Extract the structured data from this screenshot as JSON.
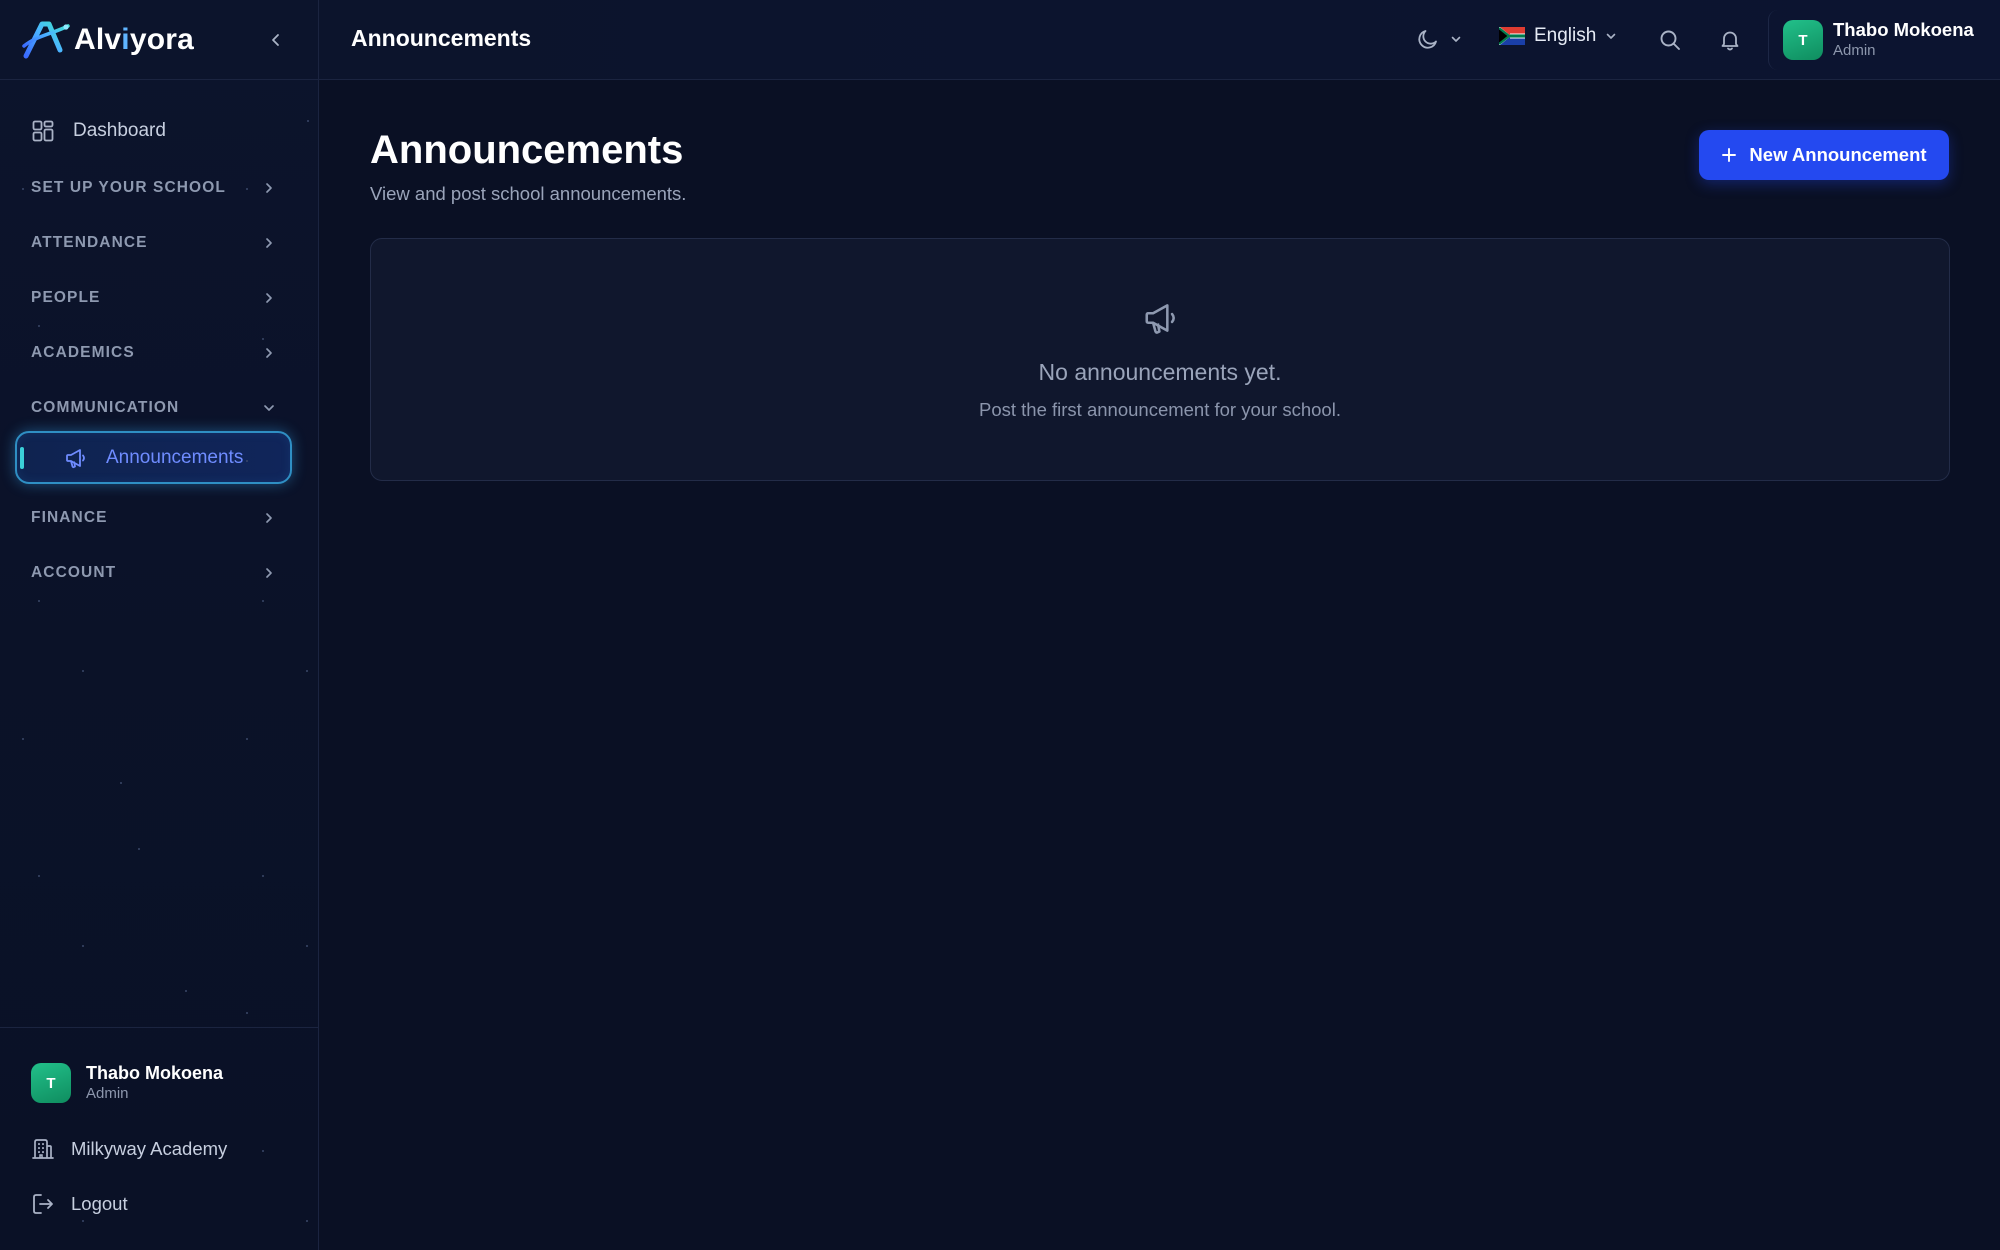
{
  "brand": {
    "name_part1": "Alv",
    "name_accent": "i",
    "name_part2": "yora"
  },
  "sidebar": {
    "dashboard_label": "Dashboard",
    "sections": [
      {
        "label": "SET UP YOUR SCHOOL",
        "expanded": false
      },
      {
        "label": "ATTENDANCE",
        "expanded": false
      },
      {
        "label": "PEOPLE",
        "expanded": false
      },
      {
        "label": "ACADEMICS",
        "expanded": false
      },
      {
        "label": "COMMUNICATION",
        "expanded": true
      },
      {
        "label": "FINANCE",
        "expanded": false
      },
      {
        "label": "ACCOUNT",
        "expanded": false
      }
    ],
    "active_item": {
      "label": "Announcements",
      "icon": "megaphone-icon"
    },
    "user": {
      "initial": "T",
      "name": "Thabo Mokoena",
      "role": "Admin"
    },
    "school_label": "Milkyway Academy",
    "logout_label": "Logout"
  },
  "header": {
    "title": "Announcements",
    "language": "English",
    "user": {
      "initial": "T",
      "name": "Thabo Mokoena",
      "role": "Admin"
    }
  },
  "main": {
    "title": "Announcements",
    "subtitle": "View and post school announcements.",
    "new_button_label": "New Announcement",
    "empty_state": {
      "title": "No announcements yet.",
      "subtitle": "Post the first announcement for your school."
    }
  },
  "colors": {
    "background": "#0a1024",
    "accent": "#2449f0",
    "active_text": "#6f8cff",
    "active_border": "#2f8fc4",
    "avatar": "#1aa876"
  }
}
